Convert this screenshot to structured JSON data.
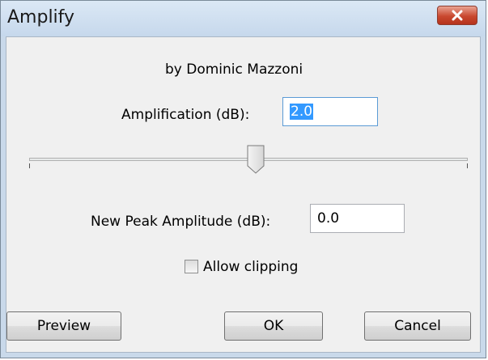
{
  "window": {
    "title": "Amplify",
    "close_icon": "close-x-icon",
    "close_color": "#c9482f"
  },
  "dialog": {
    "author": "by Dominic Mazzoni",
    "amplification_label": "Amplification (dB):",
    "amplification_value": "2.0",
    "slider_level_fraction": 0.52,
    "peak_label": "New Peak Amplitude (dB):",
    "peak_value": "0.0",
    "allow_clipping_label": "Allow clipping",
    "allow_clipping_checked": false
  },
  "buttons": {
    "preview": "Preview",
    "ok": "OK",
    "cancel": "Cancel"
  }
}
